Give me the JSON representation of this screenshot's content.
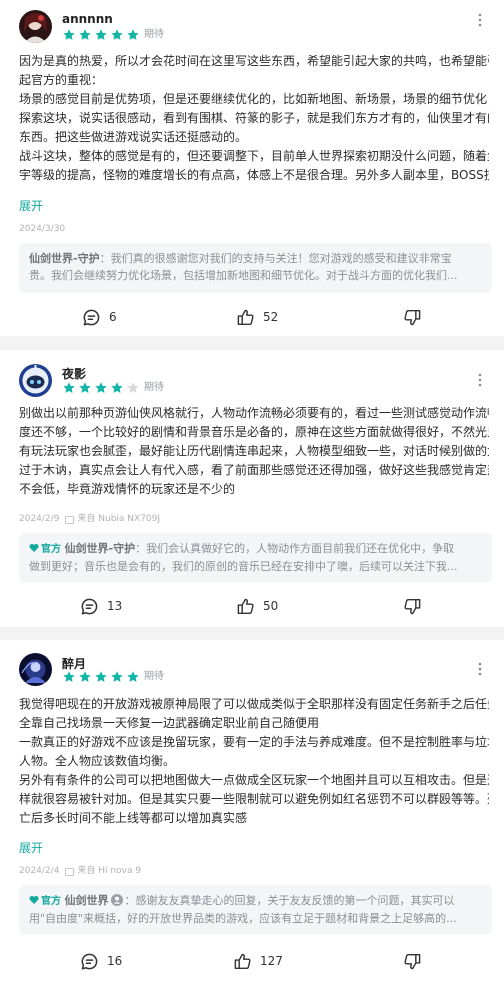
{
  "reviews": [
    {
      "username": "annnnn",
      "rating": 5,
      "tag": "期待",
      "content_lines": [
        "因为是真的热爱，所以才会花时间在这里写这些东西，希望能引起大家的共鸣，也希望能引",
        "起官方的重视：",
        "场景的感觉目前是优势项，但是还要继续优化的，比如新地图、新场景，场景的细节优化；",
        "探索这块，说实话很感动，看到有围棋、符篆的影子，就是我们东方才有的，仙侠里才有的",
        "东西。把这些做进游戏说实话还挺感动的。",
        "战斗这块，整体的感觉是有的，但还要调整下，目前单人世界探索初期没什么问题，随着尘",
        "宇等级的提高，怪物的难度增长的有点高，体感上不是很合理。另外多人副本里，BOSS技能"
      ],
      "expand_label": "展开",
      "date": "2024/3/30",
      "device": "",
      "reply": {
        "official_badge": "",
        "author": "仙剑世界-守护",
        "lines": [
          "：我们真的很感谢您对我们的支持与关注！您对游戏的感受和建议非常宝",
          "贵。我们会继续努力优化场景，包括增加新地图和细节优化。对于战斗方面的优化我们..."
        ]
      },
      "comments": "6",
      "likes": "52"
    },
    {
      "username": "夜影",
      "rating": 4,
      "tag": "期待",
      "content_lines": [
        "别做出以前那种页游仙侠风格就行，人物动作流畅必须要有的，看过一些测试感觉动作流畅",
        "度还不够，一个比较好的剧情和背景音乐是必备的，原神在这些方面就做得很好，不然光只",
        "有玩法玩家也会腻歪，最好能让历代剧情连串起来，人物模型细致一些，对话时候别做的太",
        "过于木讷，真实点会让人有代入感，看了前面那些感觉还还得加强，做好这些我感觉肯定热度",
        "不会低，毕竟游戏情怀的玩家还是不少的"
      ],
      "expand_label": "",
      "date": "2024/2/9",
      "device": "来自 Nubia NX709J",
      "reply": {
        "official_badge": "官方",
        "author": "仙剑世界-守护",
        "lines": [
          "：我们会认真做好它的，人物动作方面目前我们还在优化中，争取",
          "做到更好；音乐也是会有的，我们的原创的音乐已经在安排中了噢，后续可以关注下我..."
        ]
      },
      "comments": "13",
      "likes": "50"
    },
    {
      "username": "醉月",
      "rating": 5,
      "tag": "期待",
      "content_lines": [
        "我觉得吧现在的开放游戏被原神局限了可以做成类似于全职那样没有固定任务新手之后任务",
        "全靠自己找场景一天修复一边武器确定职业前自己随便用",
        "一款真正的好游戏不应该是挽留玩家，要有一定的手法与养成难度。但不是控制胜率与垃圾",
        "人物。全人物应该数值均衡。",
        "另外有有条件的公司可以把地图做大一点做成全区玩家一个地图并且可以互相攻击。但是这",
        "样就很容易被针对加。但是其实只要一些限制就可以避免例如红名惩罚不可以群殴等等。死",
        "亡后多长时间不能上线等都可以增加真实感"
      ],
      "expand_label": "展开",
      "date": "2024/2/4",
      "device": "来自 Hi nova 9",
      "reply": {
        "official_badge": "官方",
        "author": "仙剑世界",
        "lines": [
          "：感谢友友真挚走心的回复，关于友友反馈的第一个问题，其实可以",
          "用\"自由度\"来概括，好的开放世界品类的游戏，应该有立足于题材和背景之上足够高的..."
        ]
      },
      "comments": "16",
      "likes": "127"
    }
  ],
  "colors": {
    "accent": "#13a89e",
    "star_on": "#14b5a6",
    "star_off": "#d9d9d9",
    "reply_bg": "#f4f5f6"
  },
  "icons": {
    "comment": "comment-icon",
    "like": "thumbs-up-icon",
    "dislike": "thumbs-down-icon",
    "more": "more-vertical-icon"
  }
}
